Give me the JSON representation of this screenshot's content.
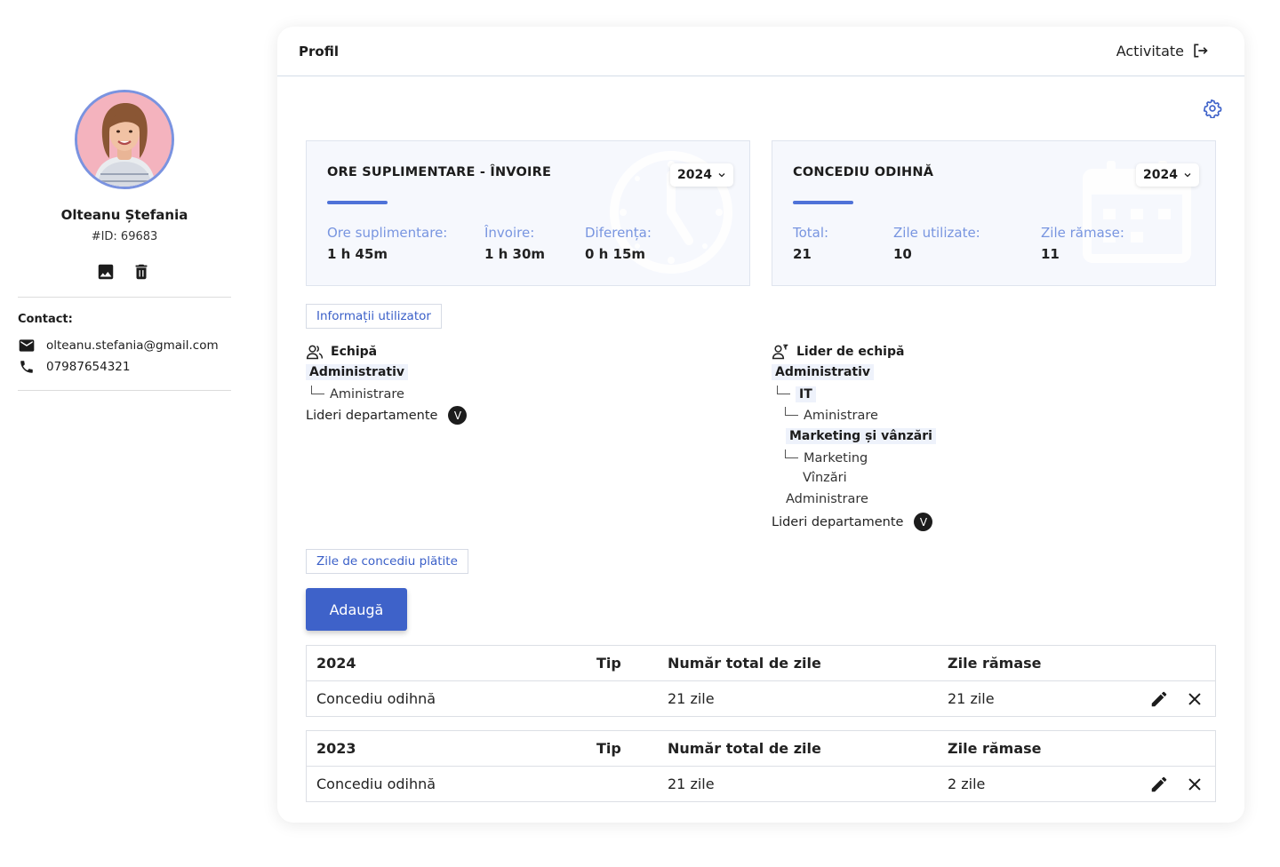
{
  "profile": {
    "name": "Olteanu Ștefania",
    "id_label": "#ID: 69683",
    "contact_title": "Contact:",
    "email": "olteanu.stefania@gmail.com",
    "phone": "07987654321"
  },
  "header": {
    "title": "Profil",
    "activity_label": "Activitate"
  },
  "overtime": {
    "title": "ORE SUPLIMENTARE - ÎNVOIRE",
    "year": "2024",
    "items": [
      {
        "label": "Ore suplimentare:",
        "value": "1 h 45m"
      },
      {
        "label": "Învoire:",
        "value": "1 h 30m"
      },
      {
        "label": "Diferența:",
        "value": "0 h 15m"
      }
    ]
  },
  "leave": {
    "title": "CONCEDIU ODIHNĂ",
    "year": "2024",
    "items": [
      {
        "label": "Total:",
        "value": "21"
      },
      {
        "label": "Zile utilizate:",
        "value": "10"
      },
      {
        "label": "Zile rămase:",
        "value": "11"
      }
    ]
  },
  "user_info": {
    "section_label": "Informații utilizator",
    "team": {
      "heading": "Echipă",
      "dept": "Administrativ",
      "sub": "Aministrare",
      "leaders_label": "Lideri departamente",
      "leaders_badge": "V"
    },
    "team_lead": {
      "heading": "Lider de echipă",
      "dept": "Administrativ",
      "it": "IT",
      "it_sub": "Aministrare",
      "marketing": "Marketing și vânzări",
      "marketing_sub1": "Marketing",
      "marketing_sub2": "Vînzări",
      "admin": "Administrare",
      "leaders_label": "Lideri departamente",
      "leaders_badge": "V"
    }
  },
  "paid_leave": {
    "section_label": "Zile de concediu plătite",
    "add_label": "Adaugă",
    "tables": [
      {
        "year": "2024",
        "type_header": "Tip",
        "total_header": "Număr total de zile",
        "remaining_header": "Zile rămase",
        "row": {
          "type": "Concediu odihnă",
          "total": "21 zile",
          "remaining": "21 zile"
        }
      },
      {
        "year": "2023",
        "type_header": "Tip",
        "total_header": "Număr total de zile",
        "remaining_header": "Zile rămase",
        "row": {
          "type": "Concediu odihnă",
          "total": "21 zile",
          "remaining": "2 zile"
        }
      }
    ]
  },
  "colors": {
    "accent": "#3e62c9",
    "label_blue": "#7895e0",
    "panel_bg": "#f6f8fd",
    "avatar_ring": "#7a93e0"
  },
  "icons": [
    "image-icon",
    "trash-icon",
    "mail-icon",
    "phone-icon",
    "logout-icon",
    "gear-icon",
    "chevron-down-icon",
    "team-icon",
    "team-lead-icon",
    "edit-icon",
    "close-icon",
    "clock-watermark-icon",
    "calendar-watermark-icon"
  ]
}
